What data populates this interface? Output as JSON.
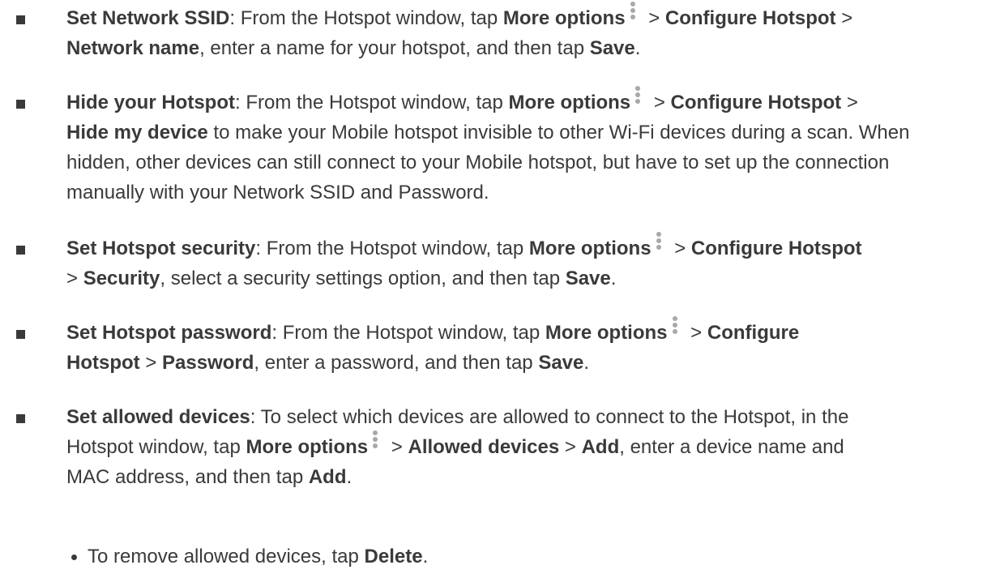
{
  "items": [
    {
      "heading": "Set Network SSID",
      "t1": ": From the Hotspot window, tap ",
      "b1": "More options",
      "t2": " > ",
      "b2": "Configure Hotspot",
      "t3": " >",
      "b3": "Network name",
      "t4": ", enter a name for your hotspot, and then tap ",
      "b4": "Save",
      "t5": "."
    },
    {
      "heading": "Hide your Hotspot",
      "t1": ": From the Hotspot window, tap ",
      "b1": "More options",
      "t2": " > ",
      "b2": "Configure Hotspot",
      "t3": " >",
      "b3": "Hide my device",
      "t4": " to make your Mobile hotspot invisible to other Wi-Fi devices during a scan. When hidden, other devices can still connect to your Mobile hotspot, but have to set up the connection manually with your Network SSID and Password."
    },
    {
      "heading": "Set Hotspot security",
      "t1": ": From the Hotspot window, tap ",
      "b1": "More options",
      "t2": " > ",
      "b2": "Configure Hotspot",
      "t3": "> ",
      "b3": "Security",
      "t4": ", select a security settings option, and then tap ",
      "b4": "Save",
      "t5": "."
    },
    {
      "heading": "Set Hotspot password",
      "t1": ": From the Hotspot window, tap ",
      "b1": "More options",
      "t2": " > ",
      "b2": "Configure",
      "b2b": "Hotspot",
      "t3": " > ",
      "b3": "Password",
      "t4": ", enter a password, and then tap ",
      "b4": "Save",
      "t5": "."
    },
    {
      "heading": "Set allowed devices",
      "t1": ": To select which devices are allowed to connect to the Hotspot, in the",
      "t1b": "Hotspot window, tap ",
      "b1": "More options",
      "t2": " > ",
      "b2": "Allowed devices",
      "t3": " > ",
      "b3": "Add",
      "t4": ", enter a device name and",
      "t4b": "MAC address, and then tap ",
      "b4": "Add",
      "t5": "."
    }
  ],
  "sub": {
    "t1": "To remove allowed devices, tap ",
    "b1": "Delete",
    "t2": "."
  },
  "icon": "more-options-vertical-dots-icon",
  "colors": {
    "text": "#3a3a3a",
    "icon": "#a8a8a8"
  }
}
